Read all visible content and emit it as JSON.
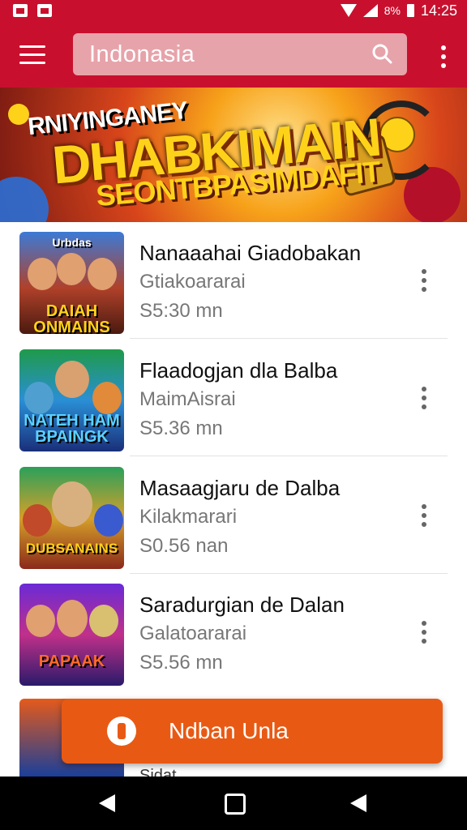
{
  "status_bar": {
    "time": "14:25",
    "battery": "8%"
  },
  "search": {
    "placeholder": "Indonasia"
  },
  "banner": {
    "line1": "RNIYINGANEY",
    "line2": "DHABKIMAIN",
    "line3": "SEONTBPASIMDAFIT"
  },
  "items": [
    {
      "title": "Nanaaahai Giadobakan",
      "subtitle": "Gtiakoararai",
      "size": "S5:30 mn",
      "thumb_top": "Urbdas",
      "thumb_bottom": "DAIAH ONMAINS"
    },
    {
      "title": "Flaadogjan dla Balba",
      "subtitle": "MaimAisrai",
      "size": "S5.36 mn",
      "thumb_top": "",
      "thumb_bottom": "NATEH HAM BPAINGK"
    },
    {
      "title": "Masaagjaru de Dalba",
      "subtitle": "Kilakmarari",
      "size": "S0.56 nan",
      "thumb_top": "",
      "thumb_bottom": "DUBSANAINS"
    },
    {
      "title": "Saradurgian de Dalan",
      "subtitle": "Galatoararai",
      "size": "S5.56 mn",
      "thumb_top": "",
      "thumb_bottom": "PAPAAK"
    }
  ],
  "peek_item": {
    "title_fragment": "Sidat"
  },
  "fab": {
    "label": "Ndban Unla"
  },
  "colors": {
    "app_bar": "#c8102e",
    "fab": "#e85a14",
    "nav_bar": "#000000"
  },
  "icons": [
    "menu-icon",
    "search-icon",
    "more-vert-icon",
    "back-icon",
    "home-icon",
    "recents-icon"
  ]
}
